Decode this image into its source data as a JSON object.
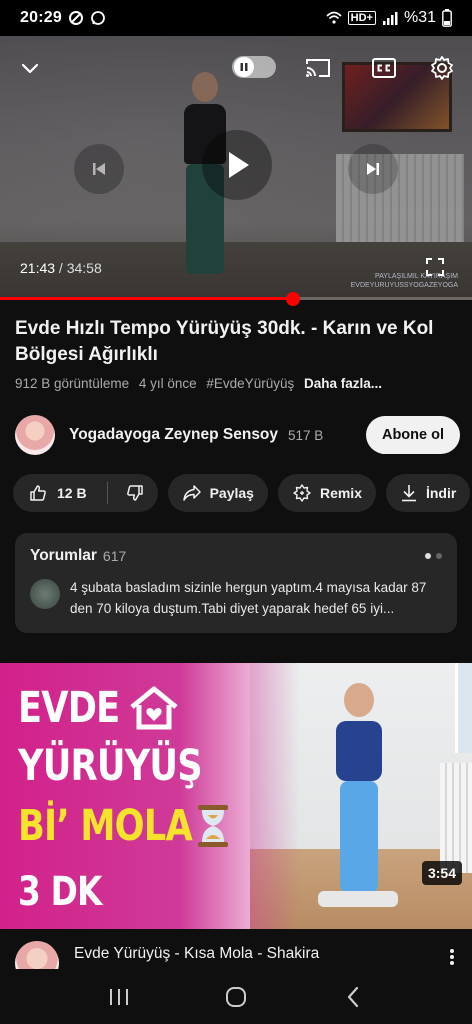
{
  "status_bar": {
    "time": "20:29",
    "battery": "%31",
    "network": "HD+"
  },
  "player": {
    "current_time": "21:43",
    "separator": " / ",
    "duration": "34:58",
    "progress_fraction": 0.621,
    "watermark_line1": "PAYLAŞILMIL KAYIRAŞIM",
    "watermark_line2": "EVDEYURUYUSSYOGAZEYOGA",
    "icons": [
      "chevron-down-icon",
      "pause-icon",
      "cast-icon",
      "cc-icon",
      "gear-icon",
      "previous-icon",
      "play-icon",
      "next-icon",
      "fullscreen-icon"
    ]
  },
  "video": {
    "title": "Evde Hızlı Tempo Yürüyüş 30dk. - Karın ve Kol Bölgesi Ağırlıklı",
    "views": "912 B görüntüleme",
    "age": "4 yıl önce",
    "hashtag": "#EvdeYürüyüş",
    "more_label": "Daha fazla..."
  },
  "channel": {
    "name": "Yogadayoga Zeynep Sensoy",
    "subscribers": "517 B",
    "subscribe_label": "Abone ol"
  },
  "actions": {
    "likes": "12 B",
    "share_label": "Paylaş",
    "remix_label": "Remix",
    "download_label": "İndir"
  },
  "comments": {
    "title": "Yorumlar",
    "count": "617",
    "top_comment": "4 şubata basladım sizinle hergun yaptım.4 mayısa kadar 87 den 70 kiloya duştum.Tabi diyet yaparak hedef 65 iyi..."
  },
  "next_video": {
    "thumbnail_lines": [
      "EVDE",
      "YÜRÜYÜŞ",
      "Bİ’ MOLA",
      "3 DK"
    ],
    "duration": "3:54",
    "title": "Evde Yürüyüş - Kısa Mola - Shakira",
    "colors": {
      "pink": "#d2218a",
      "yellow": "#f7e32b"
    }
  },
  "colors": {
    "background": "#0f0f0f",
    "chip": "#272727",
    "progress": "#ff0000"
  }
}
